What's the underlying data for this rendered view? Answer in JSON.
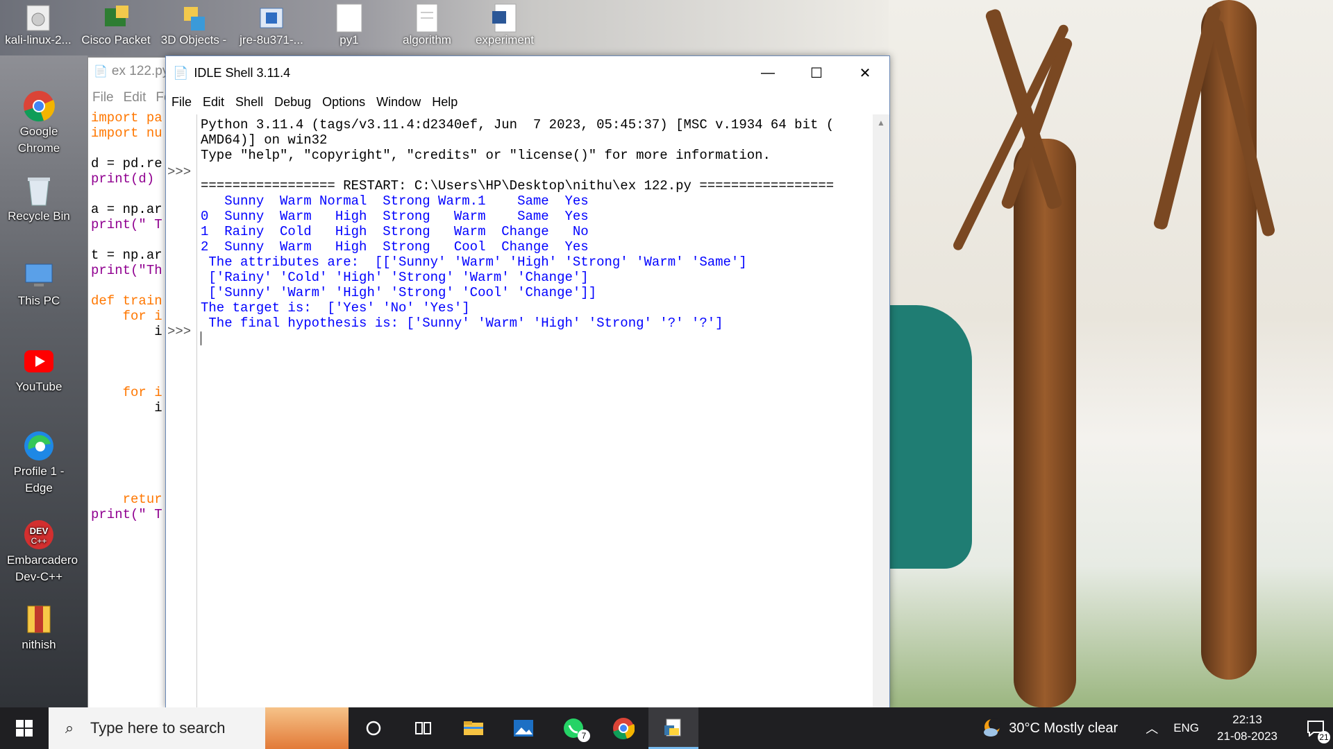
{
  "desktop": {
    "top_icons": [
      {
        "label": "kali-linux-2...",
        "icon": "disc-image-icon"
      },
      {
        "label": "Cisco Packet",
        "icon": "cisco-packet-tracer-icon"
      },
      {
        "label": "3D Objects -",
        "icon": "3d-objects-icon"
      },
      {
        "label": "jre-8u371-...",
        "icon": "java-installer-icon"
      },
      {
        "label": "py1",
        "icon": "text-file-icon"
      },
      {
        "label": "algorithm",
        "icon": "document-icon"
      },
      {
        "label": "experiment",
        "icon": "word-document-icon"
      }
    ],
    "left_icons": [
      {
        "label": "Google Chrome",
        "icon": "chrome-icon"
      },
      {
        "label": "Recycle Bin",
        "icon": "recycle-bin-icon"
      },
      {
        "label": "This PC",
        "icon": "this-pc-icon"
      },
      {
        "label": "YouTube",
        "icon": "youtube-icon"
      },
      {
        "label": "Profile 1 - Edge",
        "icon": "edge-icon"
      },
      {
        "label": "Embarcadero Dev-C++",
        "icon": "devcpp-icon"
      },
      {
        "label": "nithish",
        "icon": "archive-icon"
      }
    ]
  },
  "editor": {
    "title": "ex 122.py",
    "menu": [
      "File",
      "Edit",
      "Fo"
    ],
    "code_lines": [
      {
        "kind": "kw",
        "text": "import pa"
      },
      {
        "kind": "kw",
        "text": "import nu"
      },
      {
        "kind": "plain",
        "text": ""
      },
      {
        "kind": "plain",
        "text": "d = pd.re"
      },
      {
        "kind": "bi",
        "text": "print(d)"
      },
      {
        "kind": "plain",
        "text": ""
      },
      {
        "kind": "plain",
        "text": "a = np.ar"
      },
      {
        "kind": "bi",
        "text": "print(\" T"
      },
      {
        "kind": "plain",
        "text": ""
      },
      {
        "kind": "plain",
        "text": "t = np.ar"
      },
      {
        "kind": "bi",
        "text": "print(\"Th"
      },
      {
        "kind": "plain",
        "text": ""
      },
      {
        "kind": "kw",
        "text": "def train"
      },
      {
        "kind": "kw",
        "text": "    for i"
      },
      {
        "kind": "plain",
        "text": "        i"
      },
      {
        "kind": "plain",
        "text": ""
      },
      {
        "kind": "plain",
        "text": ""
      },
      {
        "kind": "plain",
        "text": ""
      },
      {
        "kind": "kw",
        "text": "    for i"
      },
      {
        "kind": "plain",
        "text": "        i"
      },
      {
        "kind": "plain",
        "text": ""
      },
      {
        "kind": "plain",
        "text": ""
      },
      {
        "kind": "plain",
        "text": ""
      },
      {
        "kind": "plain",
        "text": ""
      },
      {
        "kind": "plain",
        "text": ""
      },
      {
        "kind": "kw",
        "text": "    retur"
      },
      {
        "kind": "bi",
        "text": "print(\" T"
      }
    ]
  },
  "idle": {
    "title": "IDLE Shell 3.11.4",
    "menu": [
      "File",
      "Edit",
      "Shell",
      "Debug",
      "Options",
      "Window",
      "Help"
    ],
    "prompt": ">>>",
    "lines": [
      {
        "kind": "plain",
        "text": "Python 3.11.4 (tags/v3.11.4:d2340ef, Jun  7 2023, 05:45:37) [MSC v.1934 64 bit ("
      },
      {
        "kind": "plain",
        "text": "AMD64)] on win32"
      },
      {
        "kind": "plain",
        "text": "Type \"help\", \"copyright\", \"credits\" or \"license()\" for more information."
      },
      {
        "kind": "plain",
        "text": ""
      },
      {
        "kind": "plain",
        "text": "================= RESTART: C:\\Users\\HP\\Desktop\\nithu\\ex 122.py ================="
      },
      {
        "kind": "out",
        "text": "   Sunny  Warm Normal  Strong Warm.1    Same  Yes"
      },
      {
        "kind": "out",
        "text": "0  Sunny  Warm   High  Strong   Warm    Same  Yes"
      },
      {
        "kind": "out",
        "text": "1  Rainy  Cold   High  Strong   Warm  Change   No"
      },
      {
        "kind": "out",
        "text": "2  Sunny  Warm   High  Strong   Cool  Change  Yes"
      },
      {
        "kind": "out",
        "text": " The attributes are:  [['Sunny' 'Warm' 'High' 'Strong' 'Warm' 'Same']"
      },
      {
        "kind": "out",
        "text": " ['Rainy' 'Cold' 'High' 'Strong' 'Warm' 'Change']"
      },
      {
        "kind": "out",
        "text": " ['Sunny' 'Warm' 'High' 'Strong' 'Cool' 'Change']]"
      },
      {
        "kind": "out",
        "text": "The target is:  ['Yes' 'No' 'Yes']"
      },
      {
        "kind": "out",
        "text": " The final hypothesis is: ['Sunny' 'Warm' 'High' 'Strong' '?' '?']"
      },
      {
        "kind": "plain",
        "text": ""
      }
    ],
    "window_controls": {
      "minimize": "—",
      "maximize": "☐",
      "close": "✕"
    }
  },
  "taskbar": {
    "search_placeholder": "Type here to search",
    "whatsapp_badge": "7",
    "weather": "30°C  Mostly clear",
    "language": "ENG",
    "time": "22:13",
    "date": "21-08-2023",
    "notifications": "21"
  }
}
